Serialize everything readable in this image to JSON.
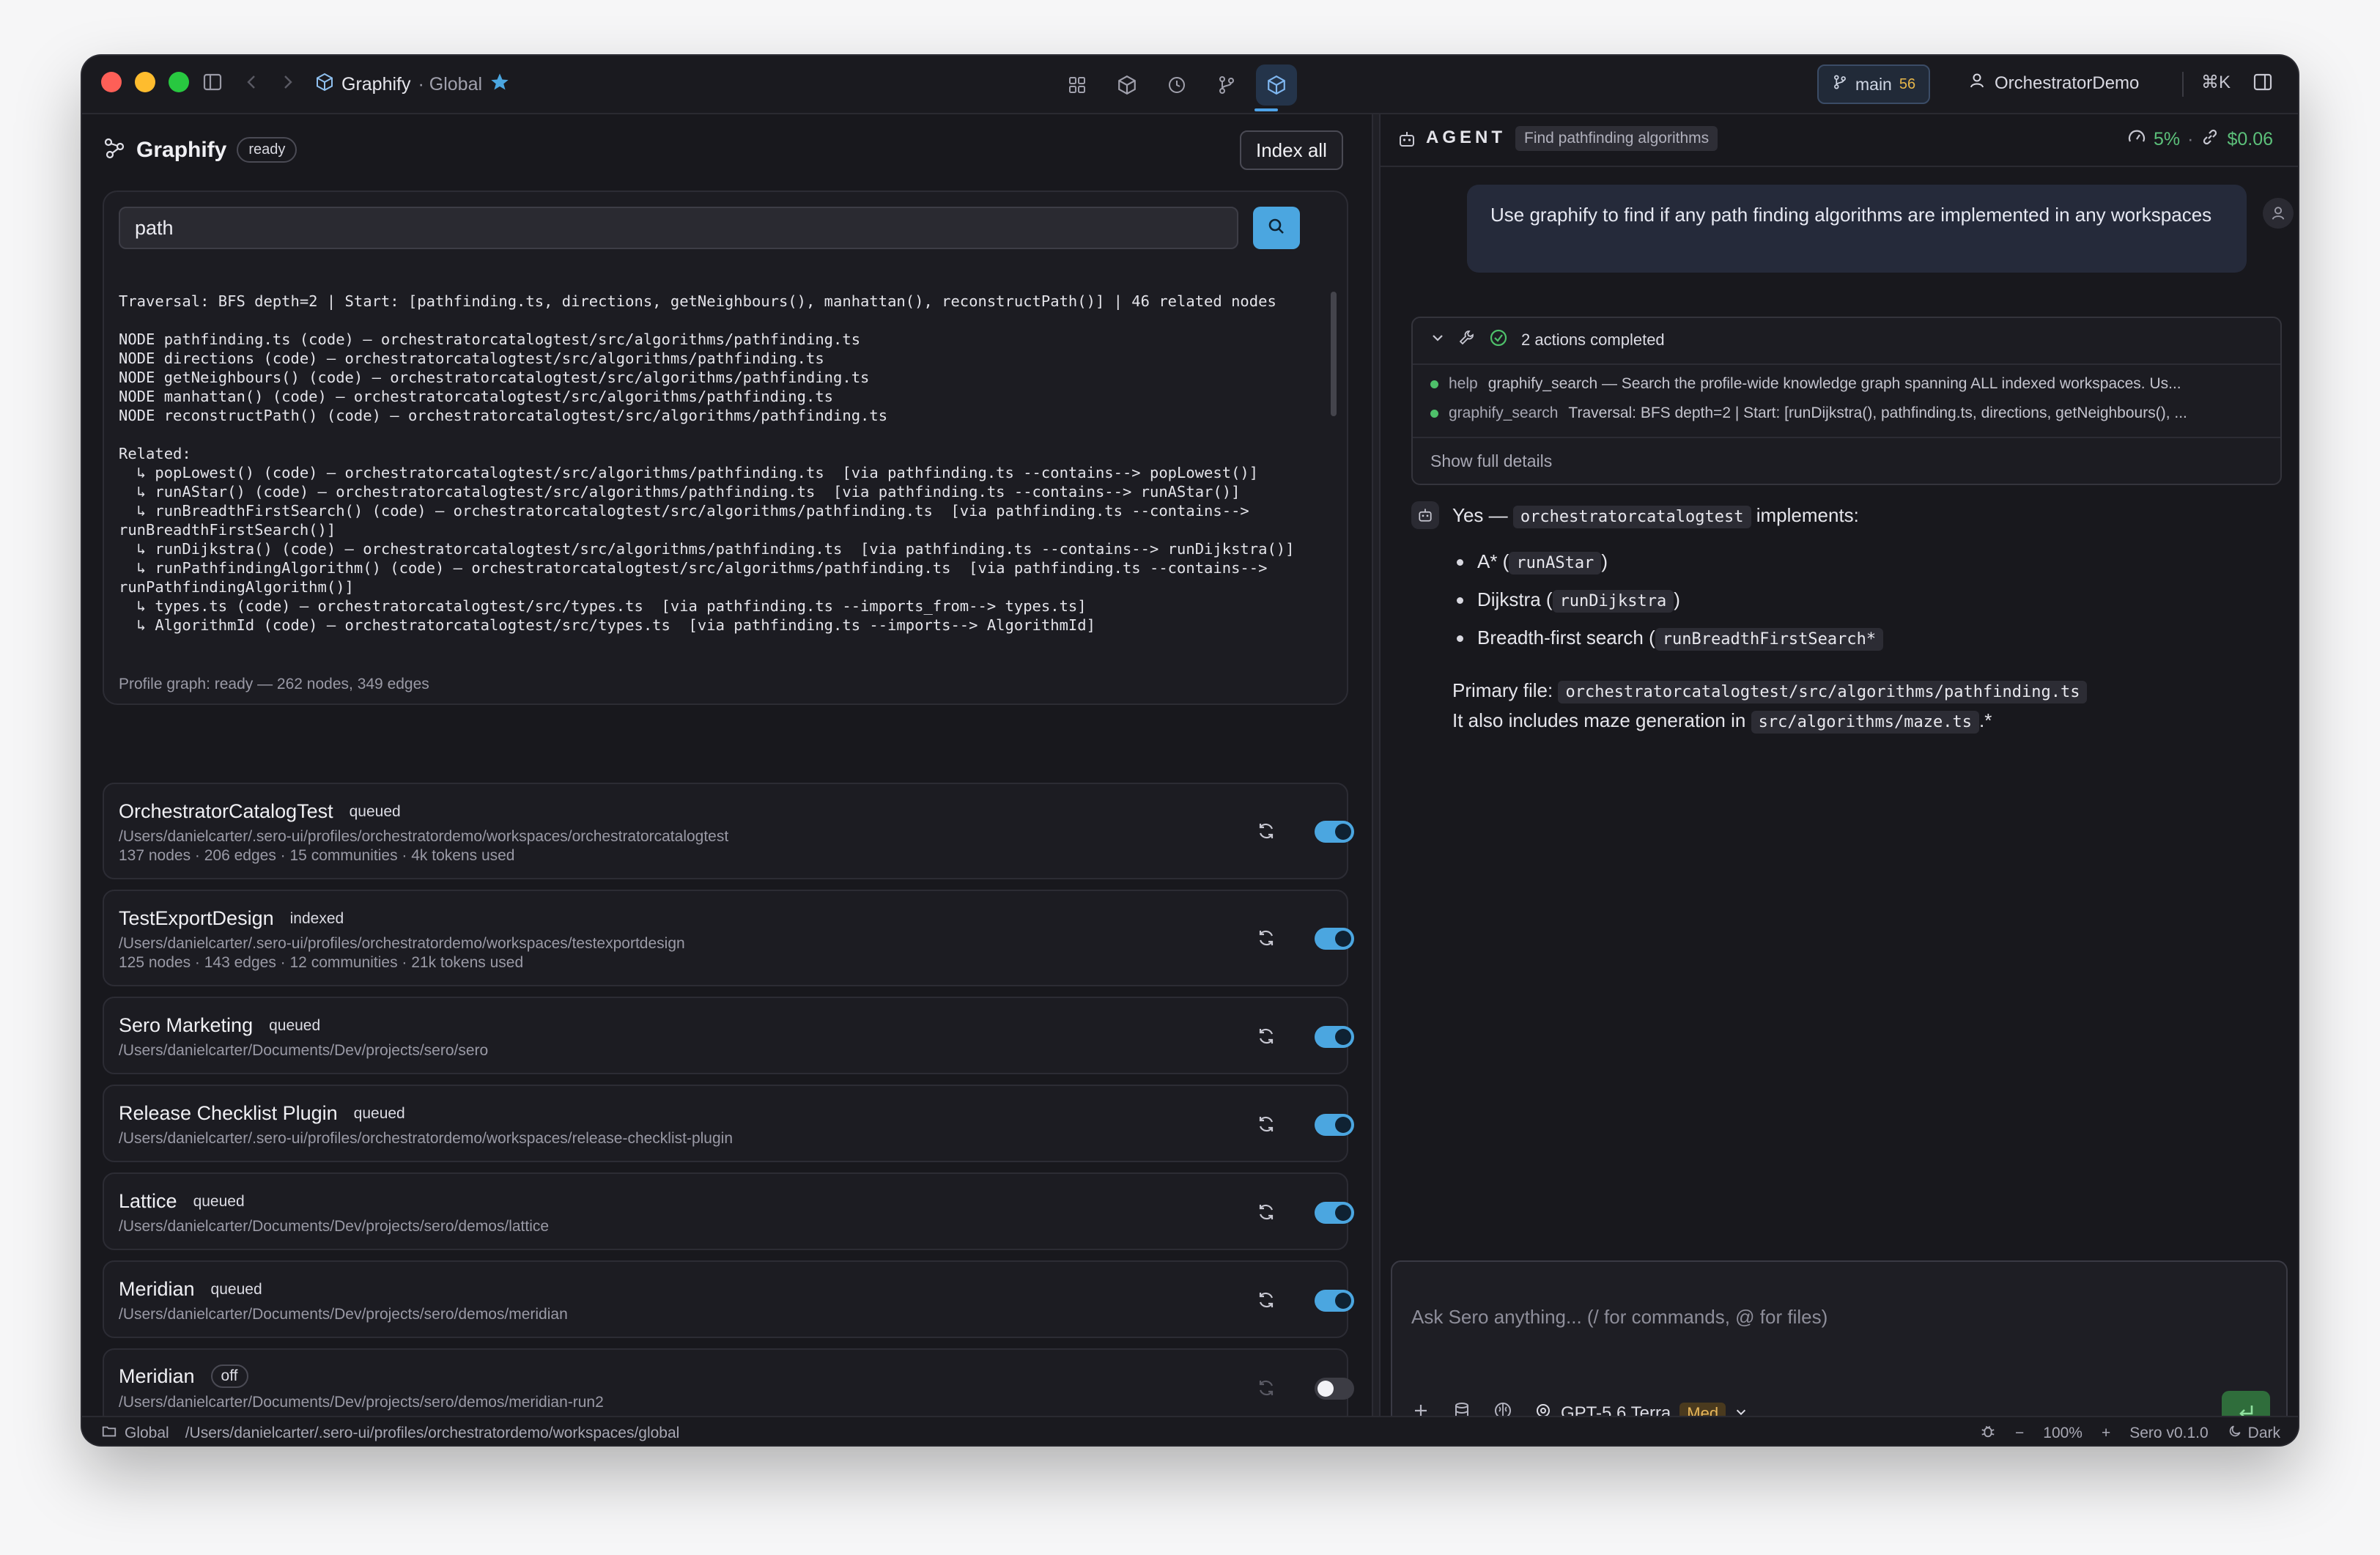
{
  "titlebar": {
    "app_name": "Graphify",
    "scope": "· Global",
    "branch": "main",
    "branch_count": "56",
    "user": "OrchestratorDemo",
    "shortcut": "⌘K"
  },
  "left": {
    "title": "Graphify",
    "status": "ready",
    "index_all": "Index all",
    "search_value": "path",
    "result_text": "Traversal: BFS depth=2 | Start: [pathfinding.ts, directions, getNeighbours(), manhattan(), reconstructPath()] | 46 related nodes\n\nNODE pathfinding.ts (code) — orchestratorcatalogtest/src/algorithms/pathfinding.ts\nNODE directions (code) — orchestratorcatalogtest/src/algorithms/pathfinding.ts\nNODE getNeighbours() (code) — orchestratorcatalogtest/src/algorithms/pathfinding.ts\nNODE manhattan() (code) — orchestratorcatalogtest/src/algorithms/pathfinding.ts\nNODE reconstructPath() (code) — orchestratorcatalogtest/src/algorithms/pathfinding.ts\n\nRelated:\n  ↳ popLowest() (code) — orchestratorcatalogtest/src/algorithms/pathfinding.ts  [via pathfinding.ts --contains--> popLowest()]\n  ↳ runAStar() (code) — orchestratorcatalogtest/src/algorithms/pathfinding.ts  [via pathfinding.ts --contains--> runAStar()]\n  ↳ runBreadthFirstSearch() (code) — orchestratorcatalogtest/src/algorithms/pathfinding.ts  [via pathfinding.ts --contains-->\nrunBreadthFirstSearch()]\n  ↳ runDijkstra() (code) — orchestratorcatalogtest/src/algorithms/pathfinding.ts  [via pathfinding.ts --contains--> runDijkstra()]\n  ↳ runPathfindingAlgorithm() (code) — orchestratorcatalogtest/src/algorithms/pathfinding.ts  [via pathfinding.ts --contains-->\nrunPathfindingAlgorithm()]\n  ↳ types.ts (code) — orchestratorcatalogtest/src/types.ts  [via pathfinding.ts --imports_from--> types.ts]\n  ↳ AlgorithmId (code) — orchestratorcatalogtest/src/types.ts  [via pathfinding.ts --imports--> AlgorithmId]",
    "profile_status": "Profile graph: ready — 262 nodes, 349 edges",
    "workspaces": [
      {
        "name": "OrchestratorCatalogTest",
        "status": "queued",
        "path": "/Users/danielcarter/.sero-ui/profiles/orchestratordemo/workspaces/orchestratorcatalogtest",
        "meta": "137 nodes · 206 edges · 15 communities · 4k tokens used"
      },
      {
        "name": "TestExportDesign",
        "status": "indexed",
        "path": "/Users/danielcarter/.sero-ui/profiles/orchestratordemo/workspaces/testexportdesign",
        "meta": "125 nodes · 143 edges · 12 communities · 21k tokens used"
      },
      {
        "name": "Sero Marketing",
        "status": "queued",
        "path": "/Users/danielcarter/Documents/Dev/projects/sero/sero"
      },
      {
        "name": "Release Checklist Plugin",
        "status": "queued",
        "path": "/Users/danielcarter/.sero-ui/profiles/orchestratordemo/workspaces/release-checklist-plugin"
      },
      {
        "name": "Lattice",
        "status": "queued",
        "path": "/Users/danielcarter/Documents/Dev/projects/sero/demos/lattice"
      },
      {
        "name": "Meridian",
        "status": "queued",
        "path": "/Users/danielcarter/Documents/Dev/projects/sero/demos/meridian"
      },
      {
        "name": "Meridian",
        "status": "off",
        "path": "/Users/danielcarter/Documents/Dev/projects/sero/demos/meridian-run2"
      }
    ]
  },
  "agent": {
    "label": "AGENT",
    "task": "Find pathfinding algorithms",
    "usage": "5%",
    "sep": "·",
    "cost": "$0.06",
    "user_message": "Use graphify to find if any path finding algorithms are implemented in any workspaces",
    "actions_summary": "2 actions completed",
    "actions": [
      {
        "key": "help",
        "text": "graphify_search — Search the profile-wide knowledge graph spanning ALL indexed workspaces. Us..."
      },
      {
        "key": "graphify_search",
        "text": "Traversal: BFS depth=2 | Start: [runDijkstra(), pathfinding.ts, directions, getNeighbours(), ..."
      }
    ],
    "show_details": "Show full details",
    "answer": {
      "yes": "Yes —",
      "repo": "orchestratorcatalogtest",
      "implements": "implements:",
      "items": [
        {
          "label": "A* (",
          "code": "runAStar",
          "end": ")"
        },
        {
          "label": "Dijkstra (",
          "code": "runDijkstra",
          "end": ")"
        },
        {
          "label": "Breadth-first search (",
          "code": "runBreadthFirstSearch*",
          "end": ""
        }
      ],
      "primary_label": "Primary file:",
      "primary_file": "orchestratorcatalogtest/src/algorithms/pathfinding.ts",
      "also_label": "It also includes maze generation in",
      "also_file": "src/algorithms/maze.ts",
      "also_end": ".*"
    },
    "composer_placeholder": "Ask Sero anything... (/ for commands, @ for files)",
    "model": "GPT-5.6 Terra",
    "effort": "Med"
  },
  "statusbar": {
    "workspace": "Global",
    "path": "/Users/danielcarter/.sero-ui/profiles/orchestratordemo/workspaces/global",
    "zoom_minus": "−",
    "zoom": "100%",
    "zoom_plus": "+",
    "version": "Sero v0.1.0",
    "theme": "Dark"
  },
  "colors": {
    "accent": "#4ba6e0",
    "success": "#5cc07a",
    "warning": "#e7b65a"
  }
}
